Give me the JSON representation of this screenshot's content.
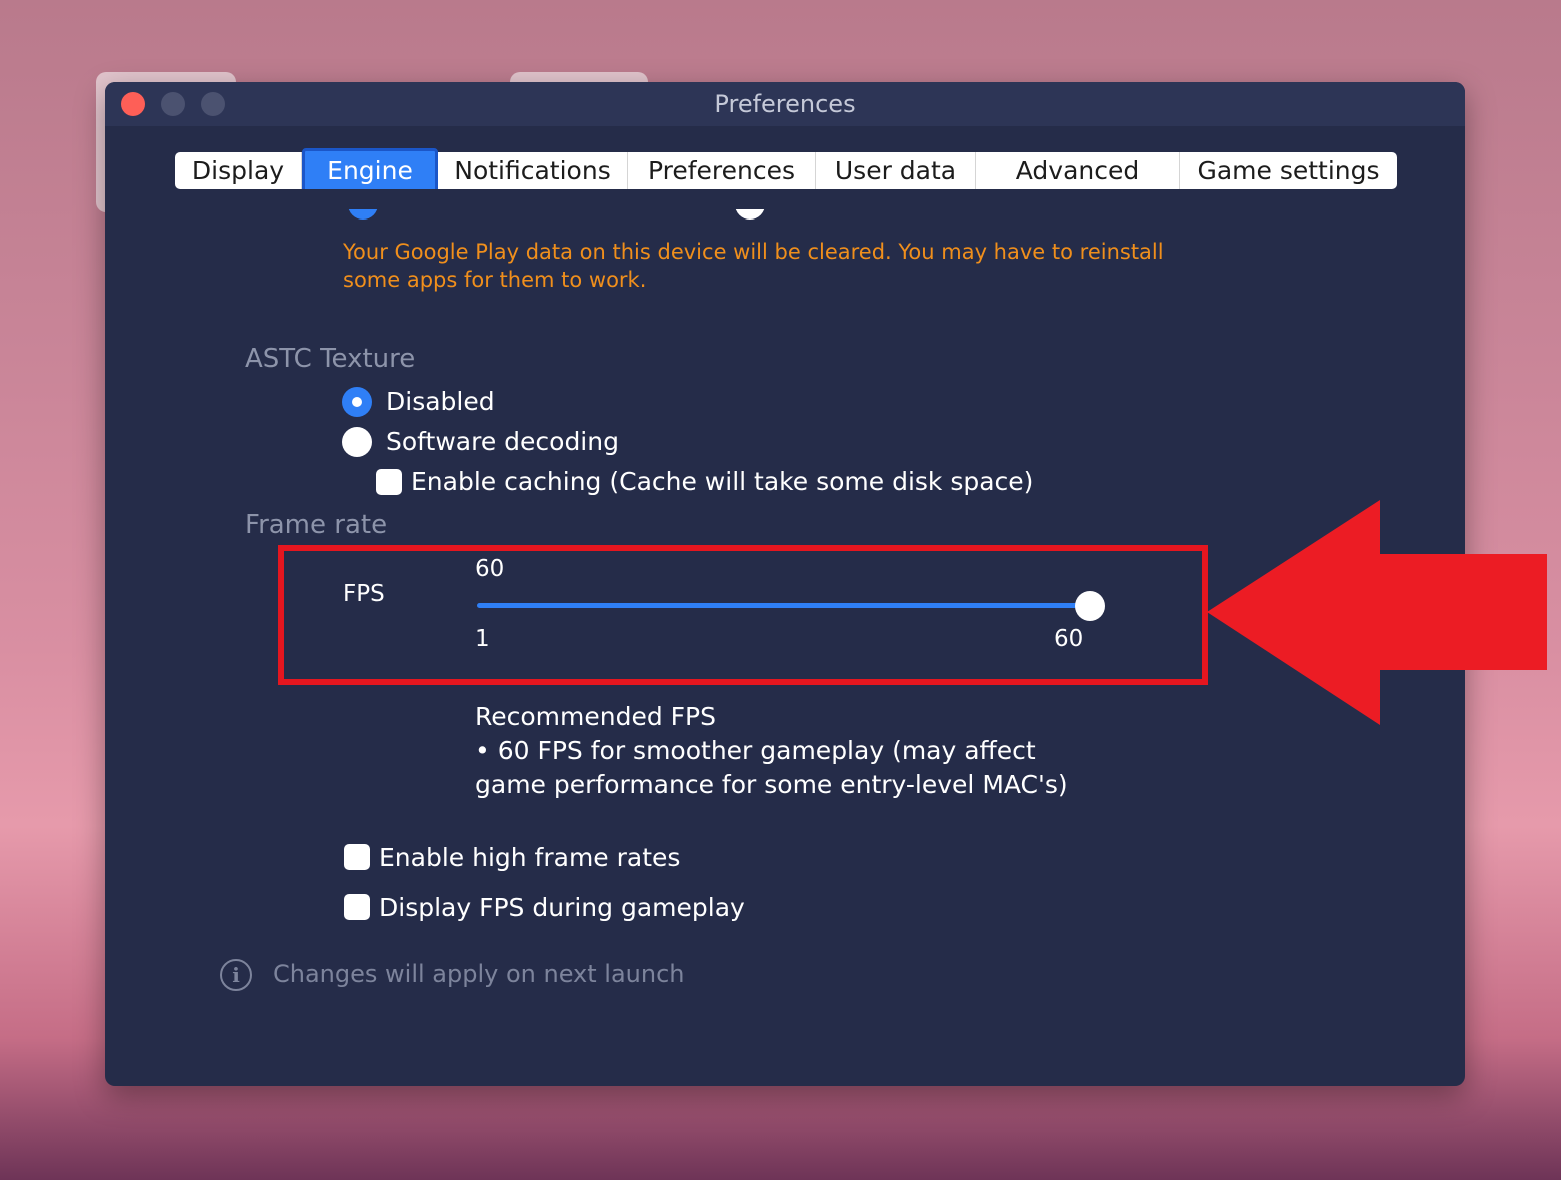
{
  "window": {
    "title": "Preferences"
  },
  "tabs": [
    {
      "label": "Display",
      "active": false
    },
    {
      "label": "Engine",
      "active": true
    },
    {
      "label": "Notifications",
      "active": false
    },
    {
      "label": "Preferences",
      "active": false
    },
    {
      "label": "User data",
      "active": false
    },
    {
      "label": "Advanced",
      "active": false
    },
    {
      "label": "Game settings",
      "active": false
    }
  ],
  "abi": {
    "warning_line1": "Your Google Play data on this device will be cleared. You may have to reinstall",
    "warning_line2": "some apps for them to work."
  },
  "astc": {
    "title": "ASTC Texture",
    "options": [
      {
        "label": "Disabled",
        "selected": true
      },
      {
        "label": "Software decoding",
        "selected": false
      }
    ],
    "caching_label": "Enable caching (Cache will take some disk space)",
    "caching_checked": false
  },
  "frame_rate": {
    "title": "Frame rate",
    "fps_label": "FPS",
    "current_value": "60",
    "min_label": "1",
    "max_label": "60",
    "recommended_title": "Recommended FPS",
    "recommended_line1": "• 60 FPS for smoother gameplay (may affect",
    "recommended_line2": "game performance for some entry-level MAC's)"
  },
  "options": {
    "high_frame_rates_label": "Enable high frame rates",
    "high_frame_rates_checked": false,
    "display_fps_label": "Display FPS during gameplay",
    "display_fps_checked": false
  },
  "footer": {
    "info_icon": "info-icon",
    "hint": "Changes will apply on next launch"
  },
  "colors": {
    "accent": "#2f7ff6",
    "warning": "#f08f1c",
    "window_bg": "#252c49",
    "highlight": "#e5161f"
  }
}
